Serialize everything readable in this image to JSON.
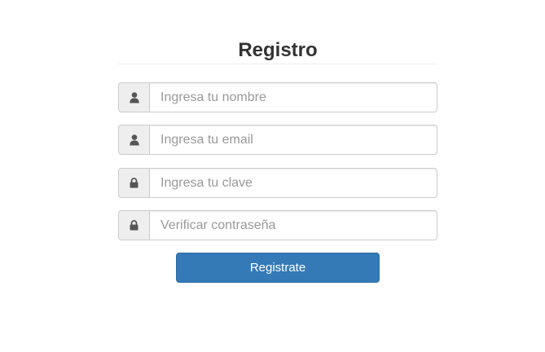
{
  "form": {
    "title": "Registro",
    "fields": [
      {
        "icon": "user-icon",
        "placeholder": "Ingresa tu nombre",
        "type": "text"
      },
      {
        "icon": "user-icon",
        "placeholder": "Ingresa tu email",
        "type": "email"
      },
      {
        "icon": "lock-icon",
        "placeholder": "Ingresa tu clave",
        "type": "password"
      },
      {
        "icon": "lock-icon",
        "placeholder": "Verificar contraseña",
        "type": "password"
      }
    ],
    "submit_label": "Registrate"
  },
  "colors": {
    "primary": "#337ab7",
    "addon_bg": "#eeeeee",
    "border": "#cccccc",
    "icon": "#555555"
  }
}
